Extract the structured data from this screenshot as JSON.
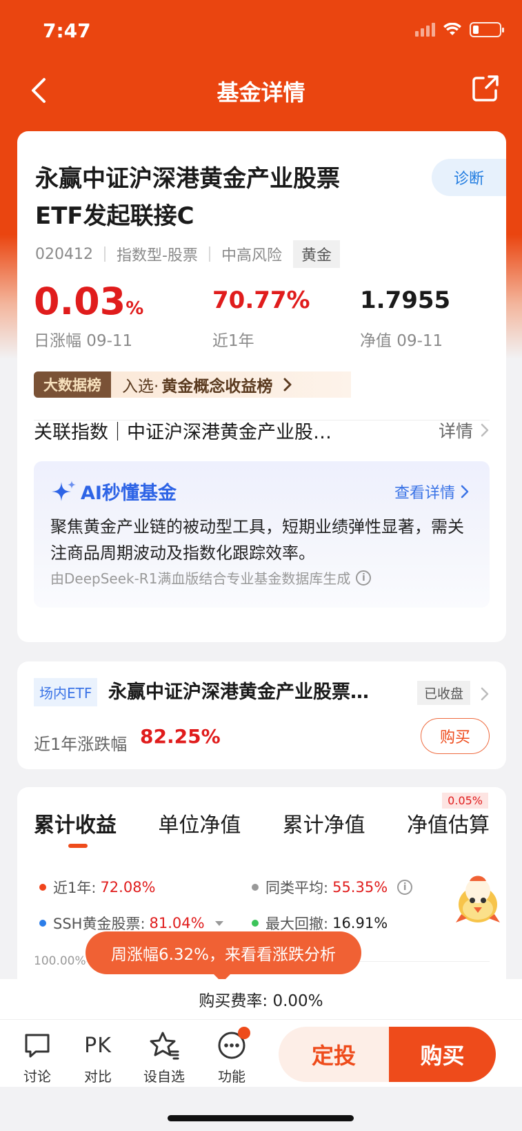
{
  "status_bar": {
    "time": "7:47"
  },
  "nav": {
    "title": "基金详情"
  },
  "fund": {
    "name_line1": "永赢中证沪深港黄金产业股票",
    "name_line2": "ETF发起联接C",
    "diagnose_label": "诊断",
    "code": "020412",
    "type": "指数型-股票",
    "risk": "中高风险",
    "tag": "黄金",
    "daily_change_value": "0.03",
    "daily_change_unit": "%",
    "daily_change_label": "日涨幅 09-11",
    "year_return_value": "70.77%",
    "year_return_label": "近1年",
    "nav_value": "1.7955",
    "nav_label": "净值 09-11",
    "bigdata_badge": "大数据榜",
    "bigdata_prefix": "入选·",
    "bigdata_list": "黄金概念收益榜",
    "index_label": "关联指数｜中证沪深港黄金产业股…",
    "index_detail": "详情"
  },
  "ai": {
    "title": "AI秒懂基金",
    "detail_link": "查看详情",
    "summary": "聚焦黄金产业链的被动型工具，短期业绩弹性显著，需关注商品周期波动及指数化跟踪效率。",
    "footer": "由DeepSeek-R1满血版结合专业基金数据库生成"
  },
  "etf": {
    "tag": "场内ETF",
    "name": "永赢中证沪深港黄金产业股票…",
    "status": "已收盘",
    "year_change_label": "近1年涨跌幅",
    "year_change_value": "82.25%",
    "buy_label": "购买"
  },
  "chart": {
    "tabs": [
      "累计收益",
      "单位净值",
      "累计净值",
      "净值估算"
    ],
    "estimate_badge": "0.05%",
    "legend": [
      {
        "label": "近1年:",
        "value": "72.08%",
        "color": "#f0441c"
      },
      {
        "label": "同类平均:",
        "value": "55.35%",
        "color": "#999999"
      },
      {
        "label": "SSH黄金股票:",
        "value": "81.04%",
        "color": "#2b7de9"
      },
      {
        "label": "最大回撤:",
        "value": "16.91%",
        "color": "#3cc45a"
      }
    ],
    "y_axis_top": "100.00%"
  },
  "toast": {
    "text": "周涨幅6.32%，来看看涨跌分析"
  },
  "fee": {
    "text": "购买费率: 0.00%"
  },
  "toolbar": {
    "discuss": "讨论",
    "pk_icon": "PK",
    "compare": "对比",
    "watchlist": "设自选",
    "functions": "功能",
    "dingtou": "定投",
    "buy": "购买"
  }
}
